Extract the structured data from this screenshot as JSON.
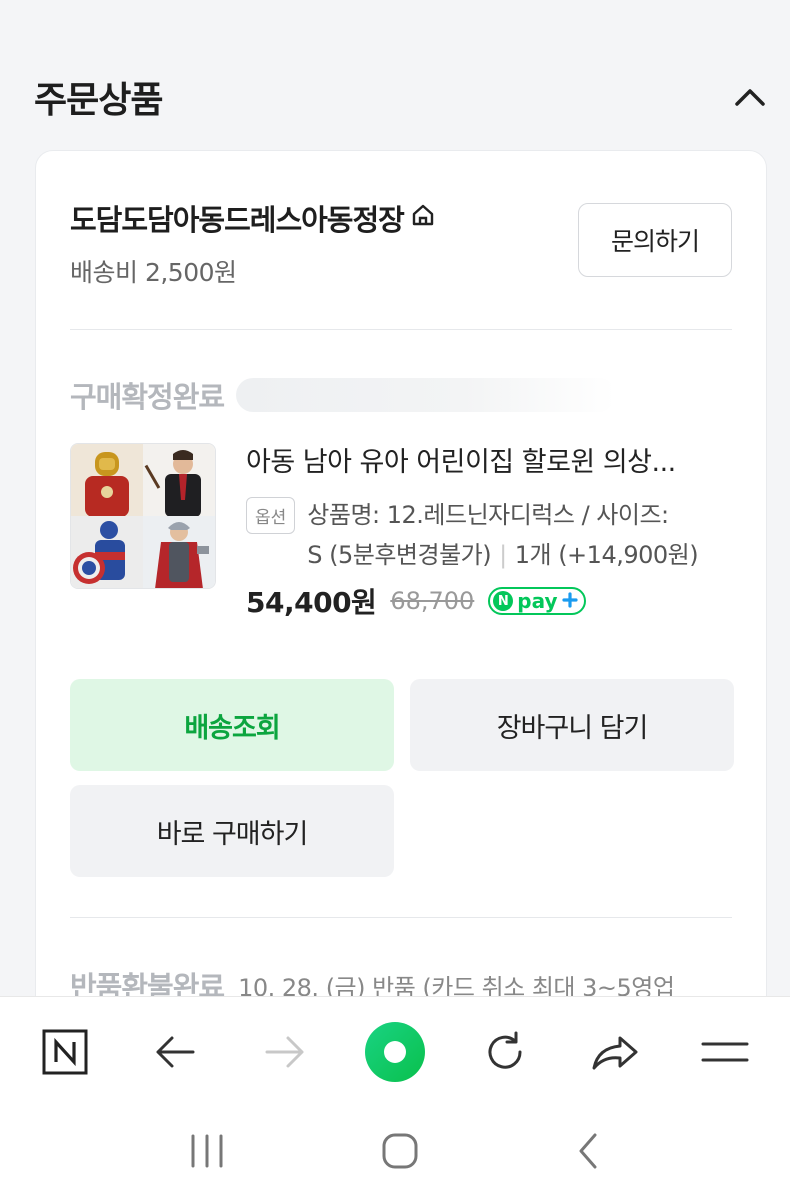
{
  "section": {
    "title": "주문상품"
  },
  "store": {
    "name": "도담도담아동드레스아동정장",
    "shipping": "배송비 2,500원",
    "inquiry_label": "문의하기"
  },
  "order": {
    "status": "구매확정완료",
    "product": {
      "title": "아동 남아 유아 어린이집 할로윈 의상...",
      "option_badge": "옵션",
      "option_line1": "상품명: 12.레드닌자디럭스 / 사이즈:",
      "option_line2": "S (5분후변경불가)",
      "quantity": "1개 (+14,900원)",
      "price": "54,400원",
      "original_price": "68,700",
      "pay_badge": "pay"
    },
    "buttons": {
      "track": "배송조회",
      "cart": "장바구니 담기",
      "buy_now": "바로 구매하기"
    }
  },
  "order2": {
    "status": "반품환불완료",
    "detail": "10. 28. (금) 반품 (카드 취소 최대 3~5영업"
  },
  "browser_bar": {
    "items": [
      "naver-n-icon",
      "back-arrow-icon",
      "forward-arrow-icon",
      "home-green-icon",
      "refresh-icon",
      "share-icon",
      "menu-icon"
    ]
  },
  "colors": {
    "accent": "#03c75a",
    "track_bg": "#dff7e5",
    "track_text": "#0ca53f"
  }
}
